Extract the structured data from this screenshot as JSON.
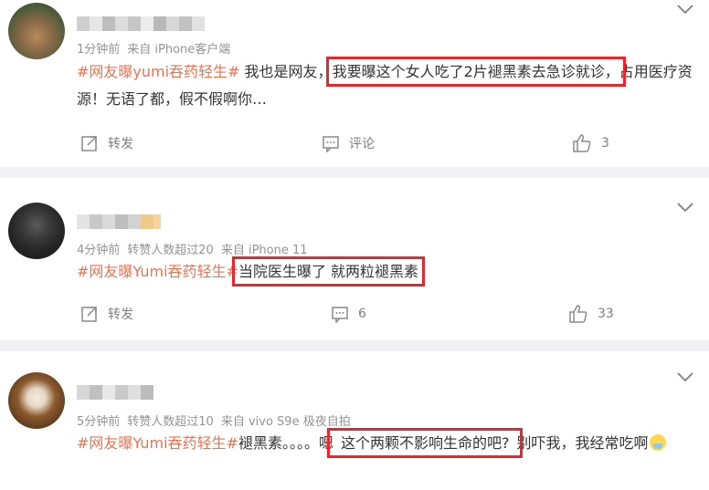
{
  "colors": {
    "hashtag": "#eb7350",
    "highlight_box": "#e8262d",
    "meta": "#939393",
    "separator": "#f2f2f5"
  },
  "comments": [
    {
      "meta": {
        "time": "1分钟前",
        "source": "来自 iPhone客户端"
      },
      "hashtag": "#网友曝yumi吞药轻生#",
      "text_before": " 我也是网友，",
      "highlight": "我要曝这个女人吃了2片褪黑素去急诊就诊，",
      "text_after": "占用医疗资源！无语了都，假不假啊你…",
      "actions": {
        "repost_label": "转发",
        "comment_label": "评论",
        "like_count": "3"
      }
    },
    {
      "meta": {
        "time": "4分钟前",
        "reposters": "转赞人数超过20",
        "source": "来自 iPhone 11"
      },
      "hashtag": "#网友曝Yumi吞药轻生#",
      "highlight": "当院医生曝了 就两粒褪黑素",
      "actions": {
        "repost_label": "转发",
        "comment_count": "6",
        "like_count": "33"
      }
    },
    {
      "meta": {
        "time": "5分钟前",
        "reposters": "转赞人数超过10",
        "source": "来自 vivo S9e 极夜自拍"
      },
      "hashtag": "#网友曝Yumi吞药轻生#",
      "text_before": "褪黑素。。。。嗯",
      "highlight": "这个两颗不影响生命的吧?",
      "text_after": "别吓我，我经常吃啊",
      "emoji": "worried-face-emoji"
    }
  ]
}
